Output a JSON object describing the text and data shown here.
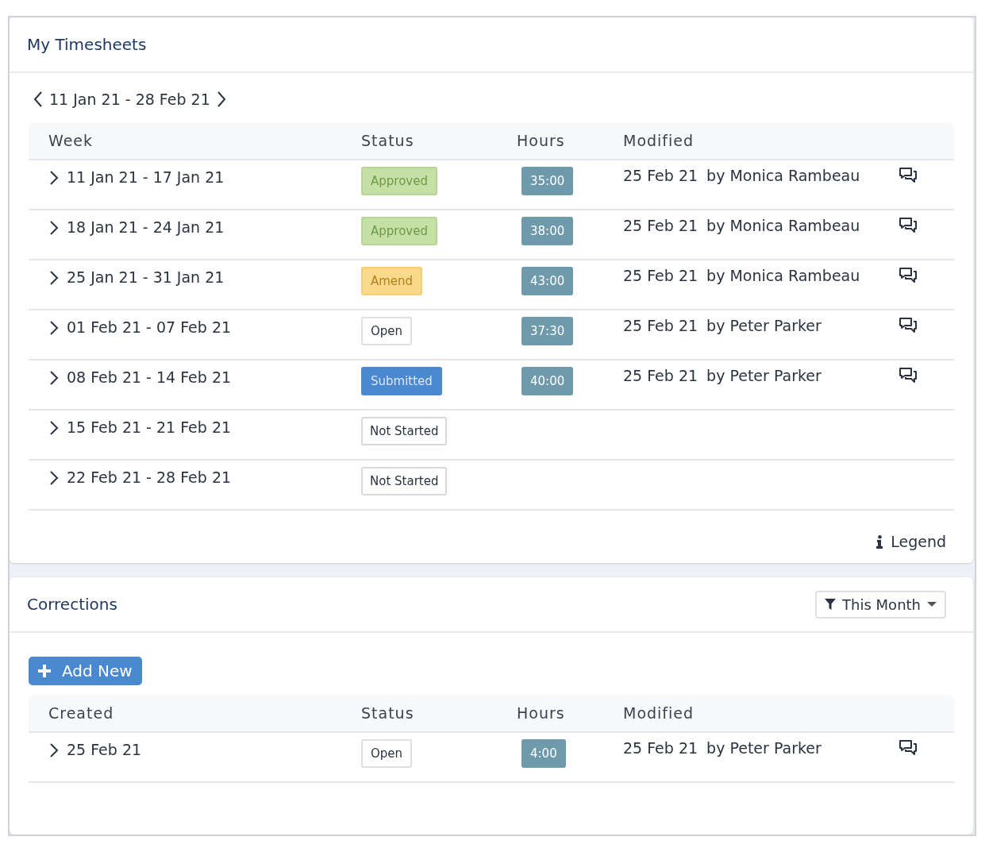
{
  "timesheets": {
    "title": "My Timesheets",
    "range": "11 Jan 21 - 28 Feb 21",
    "columns": [
      "Week",
      "Status",
      "Hours",
      "Modified"
    ],
    "rows": [
      {
        "week": "11 Jan 21 - 17 Jan 21",
        "status": {
          "label": "Approved",
          "kind": "approved"
        },
        "hours": "35:00",
        "modified_date": "25 Feb 21",
        "modified_by": "by Monica Rambeau"
      },
      {
        "week": "18 Jan 21 - 24 Jan 21",
        "status": {
          "label": "Approved",
          "kind": "approved"
        },
        "hours": "38:00",
        "modified_date": "25 Feb 21",
        "modified_by": "by Monica Rambeau"
      },
      {
        "week": "25 Jan 21 - 31 Jan 21",
        "status": {
          "label": "Amend",
          "kind": "amend"
        },
        "hours": "43:00",
        "modified_date": "25 Feb 21",
        "modified_by": "by Monica Rambeau"
      },
      {
        "week": "01 Feb 21 - 07 Feb 21",
        "status": {
          "label": "Open",
          "kind": "open"
        },
        "hours": "37:30",
        "modified_date": "25 Feb 21",
        "modified_by": "by Peter Parker"
      },
      {
        "week": "08 Feb 21 - 14 Feb 21",
        "status": {
          "label": "Submitted",
          "kind": "submitted"
        },
        "hours": "40:00",
        "modified_date": "25 Feb 21",
        "modified_by": "by Peter Parker"
      },
      {
        "week": "15 Feb 21 - 21 Feb 21",
        "status": {
          "label": "Not Started",
          "kind": "not_started"
        }
      },
      {
        "week": "22 Feb 21 - 28 Feb 21",
        "status": {
          "label": "Not Started",
          "kind": "not_started"
        }
      }
    ],
    "legend": "Legend"
  },
  "corrections": {
    "title": "Corrections",
    "filter": "This Month",
    "add_button": "Add New",
    "columns": [
      "Created",
      "Status",
      "Hours",
      "Modified"
    ],
    "rows": [
      {
        "week": "25 Feb 21",
        "status": {
          "label": "Open",
          "kind": "open"
        },
        "hours": "4:00",
        "modified_date": "25 Feb 21",
        "modified_by": "by Peter Parker"
      }
    ]
  }
}
